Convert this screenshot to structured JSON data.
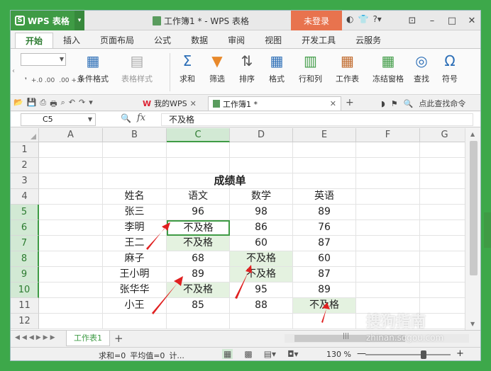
{
  "titlebar": {
    "app_name": "WPS 表格",
    "doc_title": "工作簿1 * - WPS 表格",
    "login": "未登录",
    "icons": [
      "skin-icon",
      "shirt-icon",
      "help-icon"
    ]
  },
  "menu_tabs": [
    "开始",
    "插入",
    "页面布局",
    "公式",
    "数据",
    "审阅",
    "视图",
    "开发工具",
    "云服务"
  ],
  "ribbon": {
    "conditional_format": "条件格式",
    "table_style": "表格样式",
    "sum": "求和",
    "filter": "筛选",
    "sort": "排序",
    "format": "格式",
    "row_col": "行和列",
    "worksheet": "工作表",
    "freeze": "冻结窗格",
    "find": "查找",
    "symbol": "符号",
    "decimal_inc": "+.0 .00",
    "decimal_dec": ".00 +.0"
  },
  "doc_tabs": {
    "wps_tab": "我的WPS",
    "book_tab": "工作簿1 *",
    "search_hint": "点此查找命令"
  },
  "formula_bar": {
    "cell_ref": "C5",
    "fx": "fx",
    "content": "不及格"
  },
  "columns": [
    "A",
    "B",
    "C",
    "D",
    "E",
    "F",
    "G"
  ],
  "rows": [
    "1",
    "2",
    "3",
    "4",
    "5",
    "6",
    "7",
    "8",
    "9",
    "10",
    "11",
    "12"
  ],
  "sheet": {
    "title": "成绩单",
    "headers": [
      "姓名",
      "语文",
      "数学",
      "英语"
    ],
    "records": [
      [
        "张三",
        "96",
        "98",
        "89"
      ],
      [
        "李明",
        "不及格",
        "86",
        "76"
      ],
      [
        "王二",
        "不及格",
        "60",
        "87"
      ],
      [
        "麻子",
        "68",
        "不及格",
        "60"
      ],
      [
        "王小明",
        "89",
        "不及格",
        "87"
      ],
      [
        "张华华",
        "不及格",
        "95",
        "89"
      ],
      [
        "小王",
        "85",
        "88",
        "不及格"
      ]
    ]
  },
  "sheet_tabs": {
    "name": "工作表1",
    "add": "+"
  },
  "status": {
    "sum": "求和=0",
    "avg": "平均值=0",
    "more": "计...",
    "zoom": "130 %",
    "minus": "—",
    "plus": "+"
  },
  "watermark": {
    "brand": "搜狗指南",
    "url": "zhinan.sogou.com"
  },
  "colors": {
    "accent": "#3f9b45",
    "highlight": "#e4f2e0",
    "login": "#e8734e",
    "arrow": "#e02020"
  }
}
